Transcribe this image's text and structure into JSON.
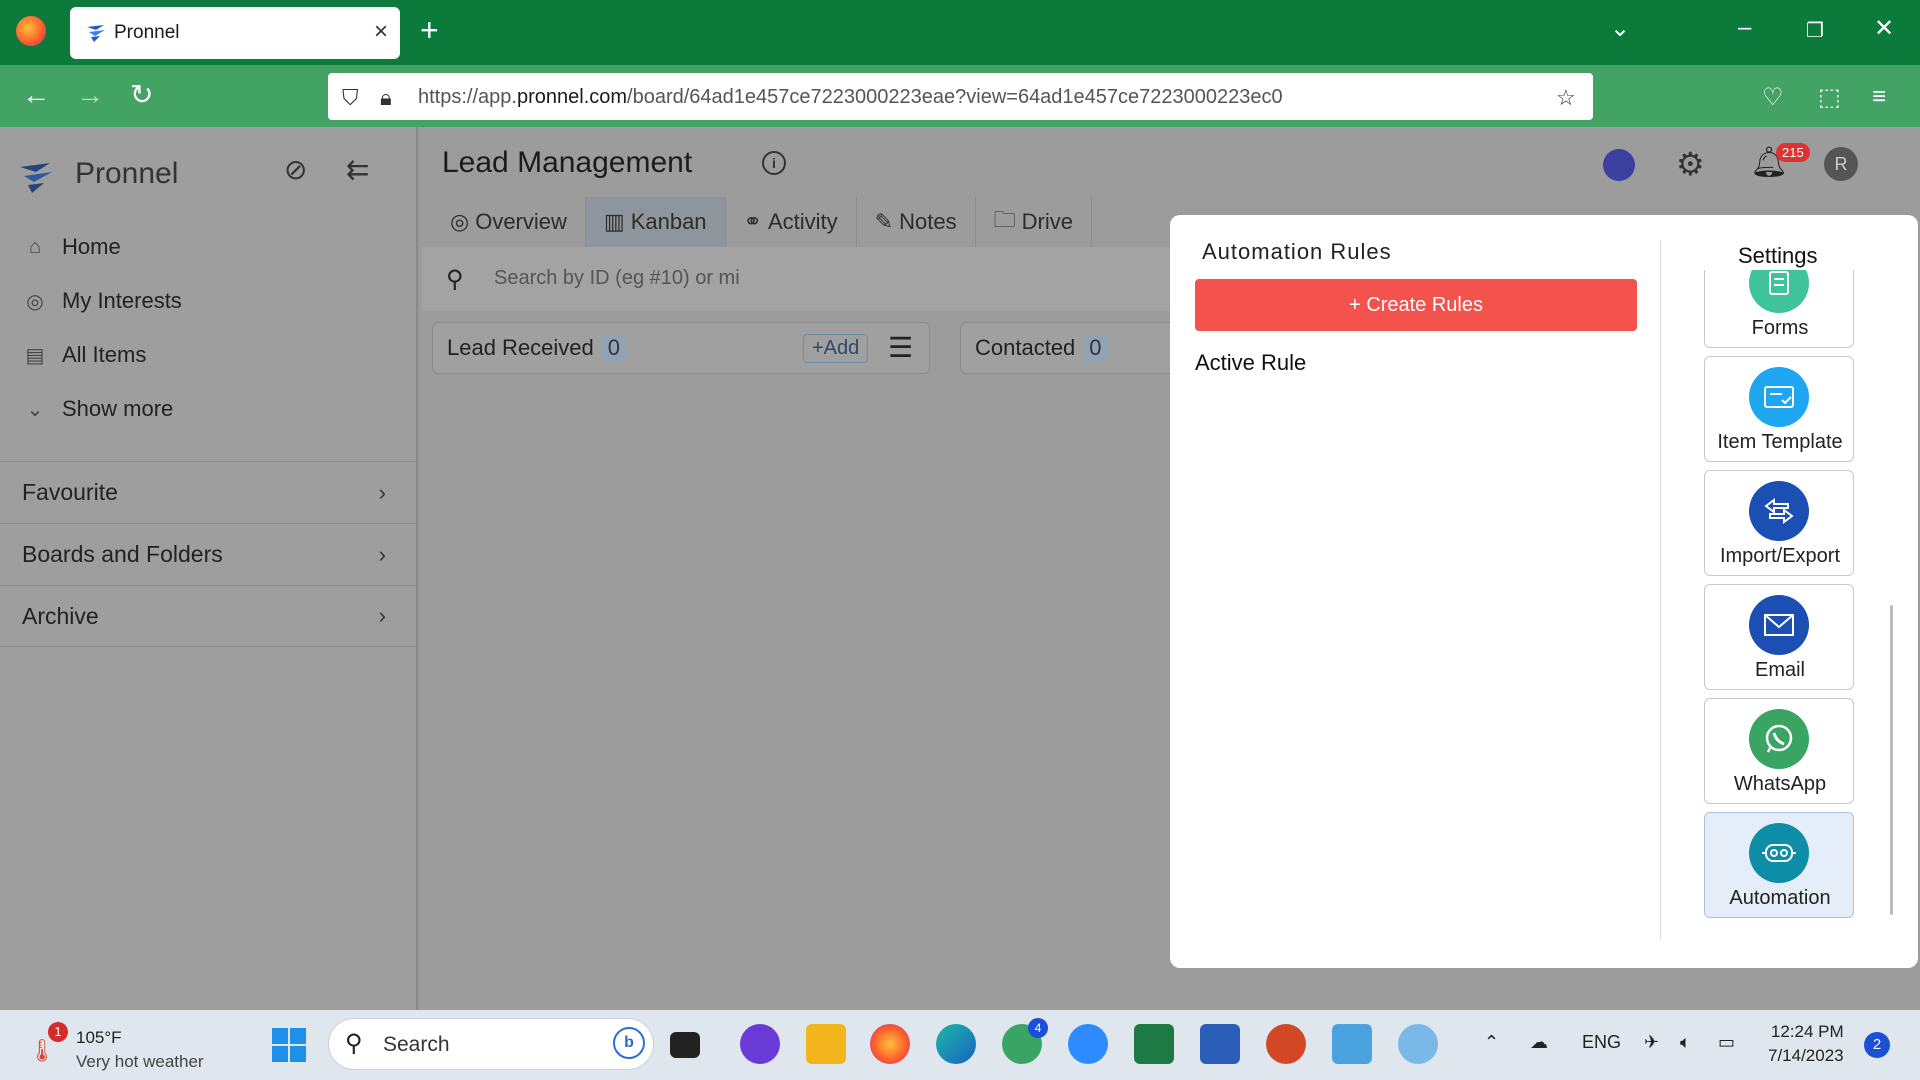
{
  "browser": {
    "tab_title": "Pronnel",
    "url_prefix": "https://app.",
    "url_domain": "pronnel.com",
    "url_path": "/board/64ad1e457ce7223000223eae?view=64ad1e457ce7223000223ec0"
  },
  "sidebar": {
    "brand": "Pronnel",
    "nav": [
      {
        "label": "Home",
        "icon": "home-icon"
      },
      {
        "label": "My Interests",
        "icon": "interests-icon"
      },
      {
        "label": "All Items",
        "icon": "items-icon"
      },
      {
        "label": "Show more",
        "icon": "chevron-down-icon"
      }
    ],
    "sections": [
      "Favourite",
      "Boards and Folders",
      "Archive"
    ]
  },
  "header": {
    "title": "Lead Management",
    "notification_count": "215",
    "avatar_initial": "R"
  },
  "tabs": [
    "Overview",
    "Kanban",
    "Activity",
    "Notes",
    "Drive"
  ],
  "active_tab": "Kanban",
  "search": {
    "placeholder": "Search by ID (eg #10) or mi"
  },
  "columns": [
    {
      "title": "Lead Received",
      "count": "0",
      "add_label": "+Add"
    },
    {
      "title": "Contacted",
      "count": "0"
    }
  ],
  "modal": {
    "title": "Automation Rules",
    "create_label": "+ Create Rules",
    "active_rule_label": "Active Rule",
    "settings_title": "Settings",
    "settings_items": [
      {
        "label": "Forms",
        "color": "#3fc39a",
        "icon": "forms-icon"
      },
      {
        "label": "Item Template",
        "color": "#1ea6f0",
        "icon": "template-icon"
      },
      {
        "label": "Import/Export",
        "color": "#1b4fb3",
        "icon": "import-export-icon"
      },
      {
        "label": "Email",
        "color": "#1b4fb3",
        "icon": "email-icon"
      },
      {
        "label": "WhatsApp",
        "color": "#3aa463",
        "icon": "whatsapp-icon"
      },
      {
        "label": "Automation",
        "color": "#0d8ea6",
        "icon": "automation-icon"
      }
    ]
  },
  "taskbar": {
    "weather_temp": "105°F",
    "weather_desc": "Very hot weather",
    "weather_badge": "1",
    "search_label": "Search",
    "whatsapp_badge": "4",
    "language": "ENG",
    "time": "12:24 PM",
    "date": "7/14/2023",
    "notifications": "2"
  },
  "colors": {
    "titlebar": "#0b7a3a",
    "navbar": "#43a364",
    "create_button": "#f4524d"
  }
}
